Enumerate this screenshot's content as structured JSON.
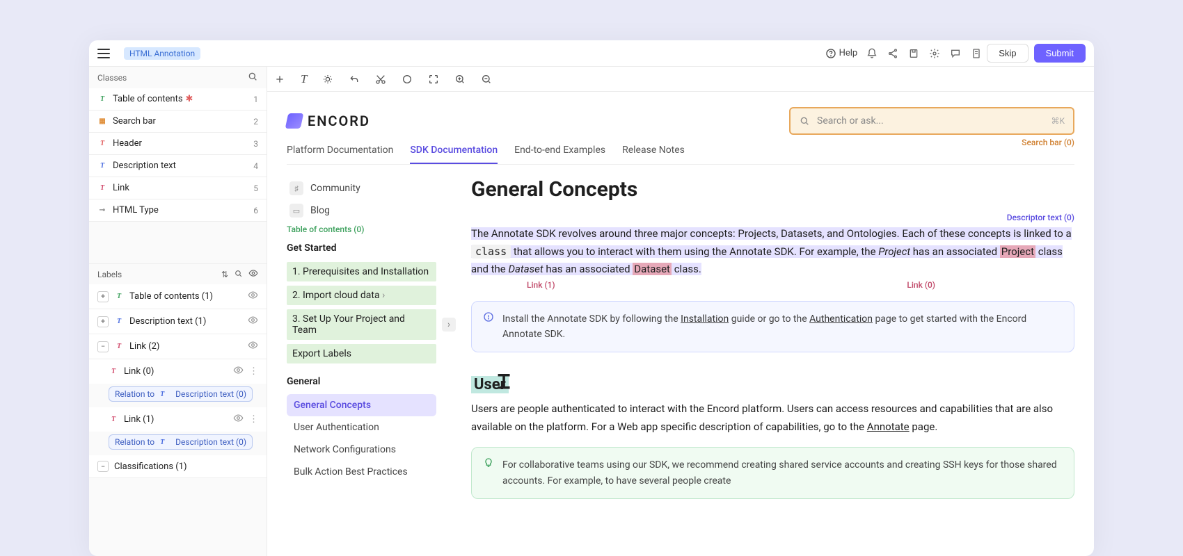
{
  "topbar": {
    "badge": "HTML Annotation",
    "help": "Help",
    "skip": "Skip",
    "submit": "Submit"
  },
  "sidebar": {
    "classes_label": "Classes",
    "classes": [
      {
        "name": "Table of contents",
        "count": "1",
        "icon": "T",
        "cls": "t-green",
        "star": true
      },
      {
        "name": "Search bar",
        "count": "2",
        "icon": "▦",
        "cls": "t-orange"
      },
      {
        "name": "Header",
        "count": "3",
        "icon": "T",
        "cls": "t-red"
      },
      {
        "name": "Description text",
        "count": "4",
        "icon": "T",
        "cls": "t-blue"
      },
      {
        "name": "Link",
        "count": "5",
        "icon": "T",
        "cls": "t-rose"
      },
      {
        "name": "HTML Type",
        "count": "6",
        "icon": "⊸",
        "cls": "t-grey"
      }
    ],
    "labels_label": "Labels",
    "labels": [
      {
        "name": "Table of contents (1)",
        "expand": "+",
        "icon": "T",
        "cls": "t-green"
      },
      {
        "name": "Description text (1)",
        "expand": "+",
        "icon": "T",
        "cls": "t-blue"
      },
      {
        "name": "Link (2)",
        "expand": "−",
        "icon": "T",
        "cls": "t-rose"
      }
    ],
    "sublinks": [
      {
        "name": "Link (0)",
        "relation_prefix": "Relation to",
        "relation": "Description text (0)"
      },
      {
        "name": "Link (1)",
        "relation_prefix": "Relation to",
        "relation": "Description text (0)"
      }
    ],
    "classifications": "Classifications (1)"
  },
  "doc": {
    "logo": "ENCORD",
    "search_placeholder": "Search or ask...",
    "search_kbd": "⌘K",
    "search_anno": "Search bar (0)",
    "tabs": [
      "Platform Documentation",
      "SDK Documentation",
      "End-to-end Examples",
      "Release Notes"
    ],
    "active_tab": 1,
    "nav": {
      "community": "Community",
      "blog": "Blog",
      "toc_label": "Table of contents (0)",
      "get_started": "Get Started",
      "steps": [
        "1. Prerequisites and Installation",
        "2. Import cloud data",
        "3. Set Up Your Project and Team",
        "Export Labels"
      ],
      "general": "General",
      "general_items": [
        "General Concepts",
        "User Authentication",
        "Network Configurations",
        "Bulk Action Best Practices"
      ],
      "general_active": 0
    },
    "h1": "General Concepts",
    "desc_anno": "Descriptor text (0)",
    "para1_a": "The Annotate SDK revolves around three major concepts: Projects, Datasets, and Ontologies. Each of these concepts is linked to a ",
    "para1_code": "class",
    "para1_b": " that allows you to interact with them using the Annotate SDK. For example, the ",
    "para1_proj_i": "Project",
    "para1_c": " has an associated ",
    "para1_proj_link": "Project",
    "para1_d": " class and the ",
    "para1_ds_i": "Dataset",
    "para1_e": " has an associated ",
    "para1_ds_link": "Dataset",
    "para1_f": " class.",
    "link0_label": "Link (0)",
    "link1_label": "Link (1)",
    "callout1_a": "Install the Annotate SDK by following the ",
    "callout1_l1": "Installation",
    "callout1_b": " guide or go to the ",
    "callout1_l2": "Authentication",
    "callout1_c": " page to get started with the Encord Annotate SDK.",
    "users_h": "User",
    "para2_a": "Users are people authenticated to interact with the Encord platform. Users can access resources and capabilities that are also available on the platform. For a Web app specific description of capabilities, go to the ",
    "para2_link": "Annotate",
    "para2_b": " page.",
    "callout2": "For collaborative teams using our SDK, we recommend creating shared service accounts and creating SSH keys for those shared accounts. For example, to have several people create"
  }
}
